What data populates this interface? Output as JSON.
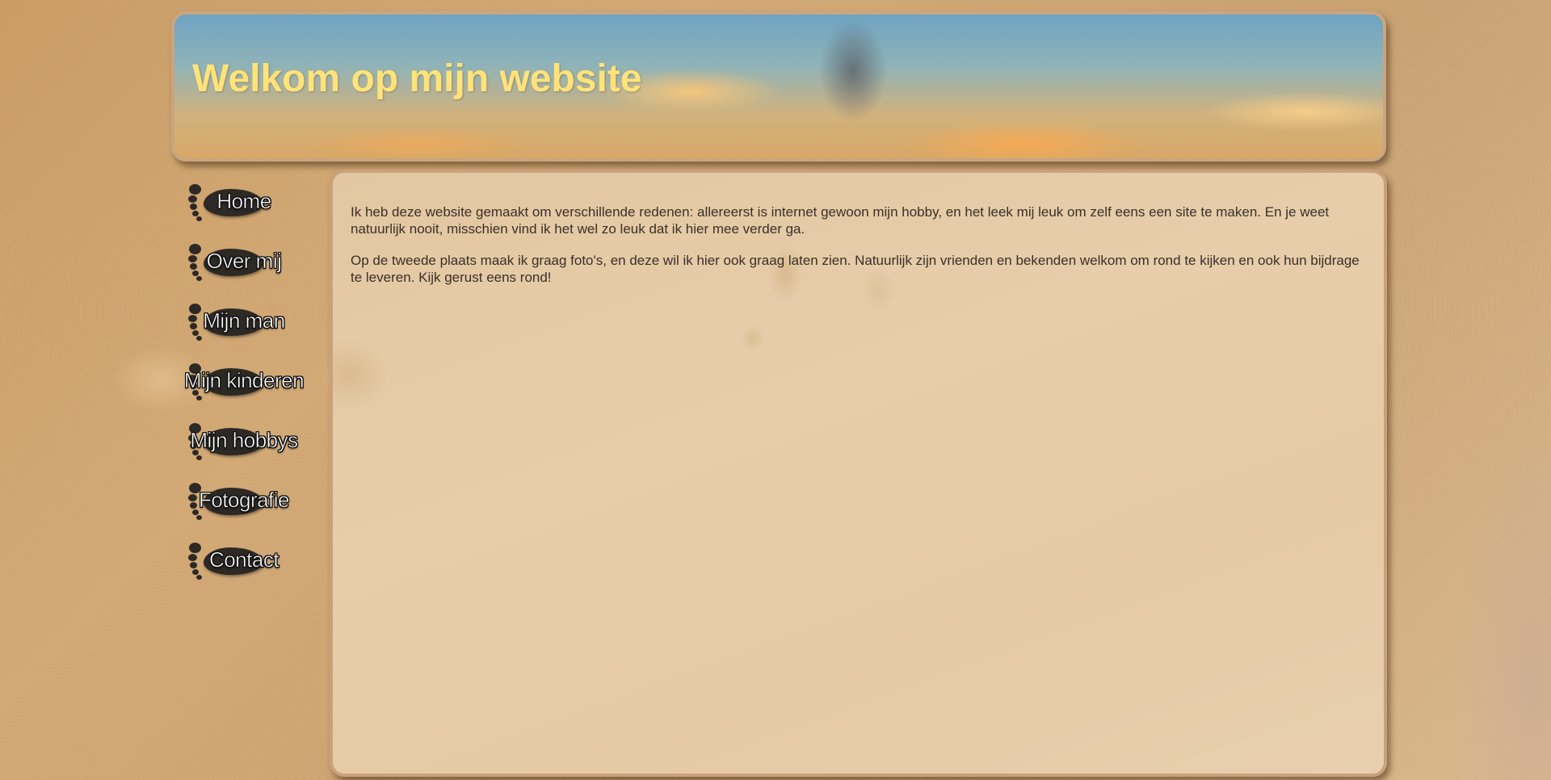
{
  "header": {
    "title": "Welkom op mijn website"
  },
  "nav": {
    "items": [
      {
        "label": "Home"
      },
      {
        "label": "Over mij"
      },
      {
        "label": "Mijn man"
      },
      {
        "label": "Mijn kinderen"
      },
      {
        "label": "Mijn hobbys"
      },
      {
        "label": "Fotografie"
      },
      {
        "label": "Contact"
      }
    ]
  },
  "main": {
    "paragraphs": [
      "Ik heb deze website gemaakt om verschillende redenen: allereerst is internet gewoon mijn hobby, en het leek mij leuk om zelf eens een site te maken. En je weet natuurlijk nooit, misschien vind ik het wel zo leuk dat ik hier mee verder ga.",
      "Op de tweede plaats maak ik graag foto's, en deze wil ik hier ook graag laten zien. Natuurlijk zijn vrienden en bekenden welkom om rond te kijken en ook hun bijdrage te leveren. Kijk gerust eens rond!"
    ]
  },
  "colors": {
    "title": "#ffe37a",
    "body_text": "#3a3028",
    "panel_border": "#caa17c",
    "footprint": "#2d2925"
  },
  "icons": {
    "nav_item_icon": "footprint-icon"
  }
}
